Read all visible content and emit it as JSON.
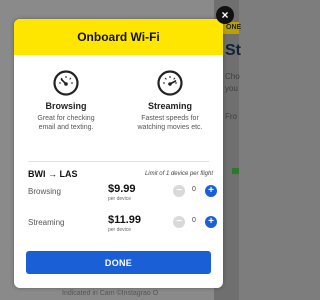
{
  "background": {
    "text_1": "ONE",
    "text_2": "St",
    "text_3": "Cho",
    "text_4": "you",
    "text_5": "Fro",
    "text_6": "Indicated in Cam ©Instagrao O",
    "accent_color": "#ffe600"
  },
  "modal": {
    "title": "Onboard Wi-Fi",
    "close_label": "×",
    "plans": [
      {
        "name": "Browsing",
        "description_line1": "Great for checking",
        "description_line2": "email and texting.",
        "icon": "speedometer-low-icon"
      },
      {
        "name": "Streaming",
        "description_line1": "Fastest speeds for",
        "description_line2": "watching movies etc.",
        "icon": "speedometer-high-icon"
      }
    ],
    "route": "BWI → LAS",
    "limit_note": "Limit of 1 device per flight",
    "rows": [
      {
        "label": "Browsing",
        "price": "$9.99",
        "per": "per device",
        "quantity": "0"
      },
      {
        "label": "Streaming",
        "price": "$11.99",
        "per": "per device",
        "quantity": "0"
      }
    ],
    "minus_label": "−",
    "plus_label": "+",
    "done_label": "DONE",
    "primary_color": "#1a5fd6"
  }
}
